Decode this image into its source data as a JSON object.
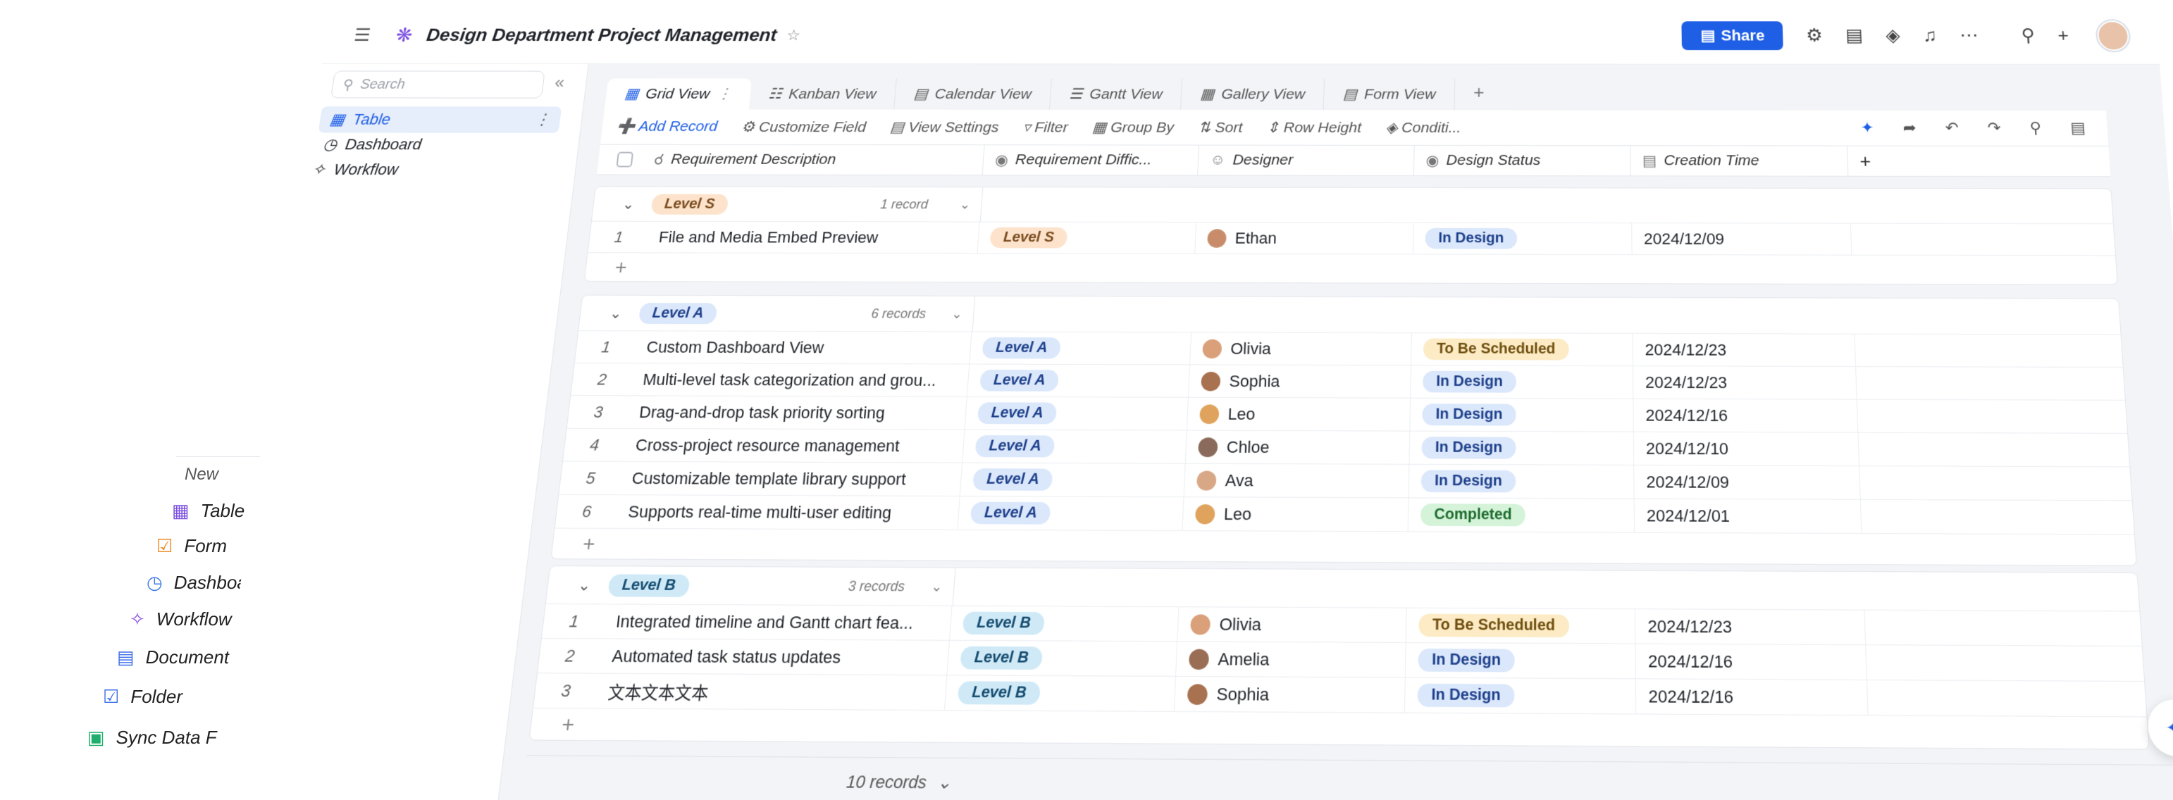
{
  "topbar": {
    "title": "Design Department Project Management",
    "share_label": "Share",
    "icons": [
      "robot-icon",
      "form-icon",
      "plugin-icon",
      "bell-icon",
      "more-icon",
      "search-icon",
      "add-icon"
    ]
  },
  "sidebar": {
    "search_placeholder": "Search",
    "items": [
      {
        "label": "Table",
        "icon": "table-icon"
      },
      {
        "label": "Dashboard",
        "icon": "dashboard-icon"
      },
      {
        "label": "Workflow",
        "icon": "workflow-icon"
      }
    ]
  },
  "tabs": [
    {
      "label": "Grid View",
      "icon": "grid-icon"
    },
    {
      "label": "Kanban View",
      "icon": "kanban-icon"
    },
    {
      "label": "Calendar View",
      "icon": "calendar-icon"
    },
    {
      "label": "Gantt View",
      "icon": "gantt-icon"
    },
    {
      "label": "Gallery View",
      "icon": "gallery-icon"
    },
    {
      "label": "Form View",
      "icon": "form-icon"
    }
  ],
  "toolbar": {
    "add_record": "Add Record",
    "customize_field": "Customize Field",
    "view_settings": "View Settings",
    "filter": "Filter",
    "group_by": "Group By",
    "sort": "Sort",
    "row_height": "Row Height",
    "conditional": "Conditi..."
  },
  "columns": {
    "description": "Requirement Description",
    "difficulty": "Requirement Diffic...",
    "designer": "Designer",
    "status": "Design Status",
    "time": "Creation Time"
  },
  "groups": [
    {
      "name": "Level S",
      "count": "1 record",
      "rows": [
        {
          "num": "1",
          "desc": "File and Media Embed Preview",
          "level": "Level S",
          "designer": "Ethan",
          "status": "In Design",
          "time": "2024/12/09"
        }
      ]
    },
    {
      "name": "Level A",
      "count": "6 records",
      "rows": [
        {
          "num": "1",
          "desc": "Custom Dashboard View",
          "level": "Level A",
          "designer": "Olivia",
          "status": "To Be Scheduled",
          "time": "2024/12/23"
        },
        {
          "num": "2",
          "desc": "Multi-level task categorization and grou...",
          "level": "Level A",
          "designer": "Sophia",
          "status": "In Design",
          "time": "2024/12/23"
        },
        {
          "num": "3",
          "desc": "Drag-and-drop task priority sorting",
          "level": "Level A",
          "designer": "Leo",
          "status": "In Design",
          "time": "2024/12/16"
        },
        {
          "num": "4",
          "desc": "Cross-project resource management",
          "level": "Level A",
          "designer": "Chloe",
          "status": "In Design",
          "time": "2024/12/10"
        },
        {
          "num": "5",
          "desc": "Customizable template library support",
          "level": "Level A",
          "designer": "Ava",
          "status": "In Design",
          "time": "2024/12/09"
        },
        {
          "num": "6",
          "desc": "Supports real-time multi-user editing",
          "level": "Level A",
          "designer": "Leo",
          "status": "Completed",
          "time": "2024/12/01"
        }
      ]
    },
    {
      "name": "Level B",
      "count": "3 records",
      "rows": [
        {
          "num": "1",
          "desc": "Integrated timeline and Gantt chart fea...",
          "level": "Level B",
          "designer": "Olivia",
          "status": "To Be Scheduled",
          "time": "2024/12/23"
        },
        {
          "num": "2",
          "desc": "Automated task status updates",
          "level": "Level B",
          "designer": "Amelia",
          "status": "In Design",
          "time": "2024/12/16"
        },
        {
          "num": "3",
          "desc": "文本文本文本",
          "level": "Level B",
          "designer": "Sophia",
          "status": "In Design",
          "time": "2024/12/16"
        }
      ]
    }
  ],
  "footer": {
    "records": "10 records"
  },
  "new_menu": {
    "title": "New",
    "items": [
      {
        "label": "Table",
        "icon": "table-icon",
        "color": "#7b4fe0"
      },
      {
        "label": "Form",
        "icon": "form-icon",
        "color": "#f08a24"
      },
      {
        "label": "Dashboard",
        "icon": "dashboard-icon",
        "color": "#3f7be8"
      },
      {
        "label": "Workflow",
        "icon": "workflow-icon",
        "color": "#8a4fe0"
      },
      {
        "label": "Document",
        "icon": "document-icon",
        "color": "#3f6fe8"
      },
      {
        "label": "Folder",
        "icon": "folder-icon",
        "color": "#3f6fe8"
      },
      {
        "label": "Sync Data From",
        "icon": "sync-icon",
        "color": "#1fae6b"
      }
    ]
  },
  "colors": {
    "accent": "#1f5fe6",
    "level_s": "#fde3cc",
    "level_a": "#dbe7fb",
    "level_b": "#cfe9f7",
    "in_design": "#dbe7fb",
    "scheduled": "#fcebc4",
    "completed": "#d4f3d8"
  }
}
